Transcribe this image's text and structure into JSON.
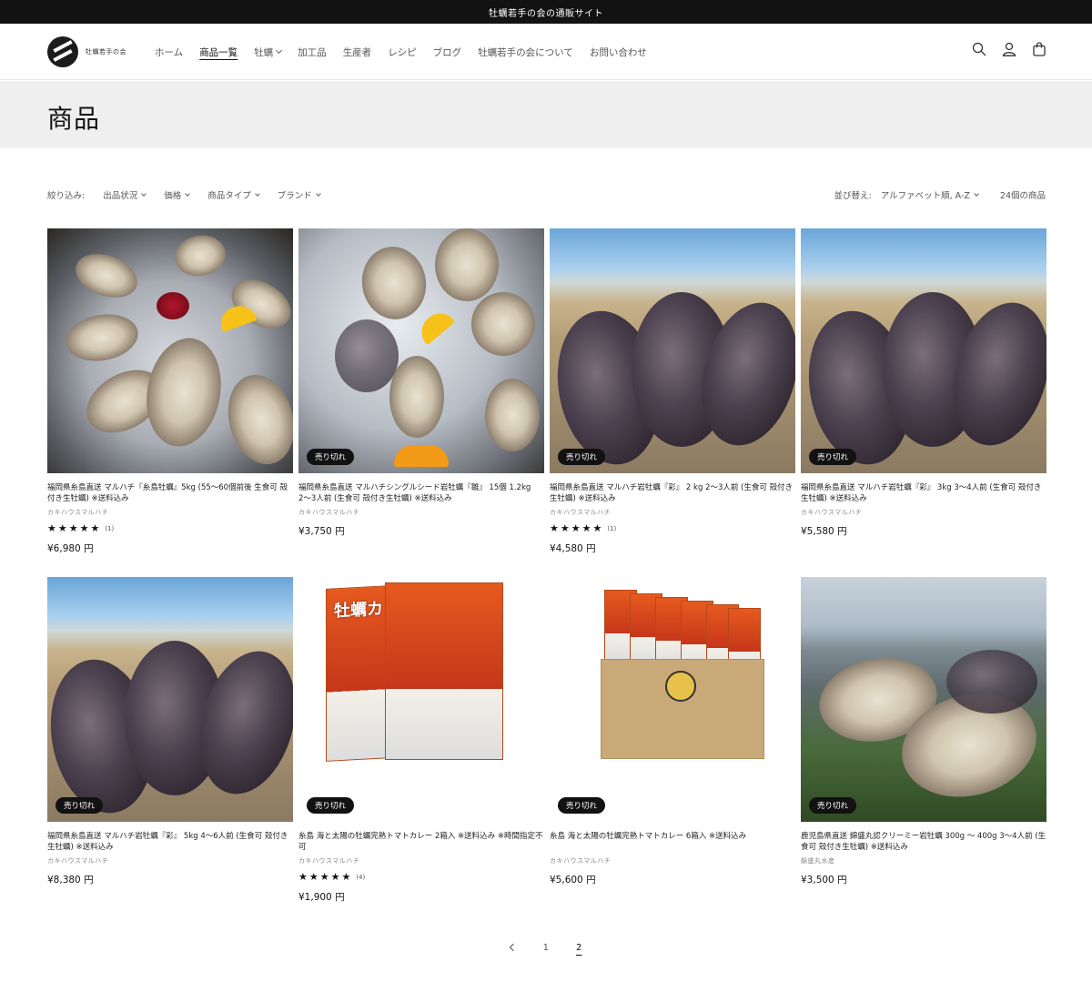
{
  "announcement": "牡蠣若手の会の通販サイト",
  "logo": {
    "text": "牡蠣若手の会"
  },
  "nav": [
    {
      "label": "ホーム",
      "active": false,
      "dropdown": false
    },
    {
      "label": "商品一覧",
      "active": true,
      "dropdown": false
    },
    {
      "label": "牡蠣",
      "active": false,
      "dropdown": true
    },
    {
      "label": "加工品",
      "active": false,
      "dropdown": false
    },
    {
      "label": "生産者",
      "active": false,
      "dropdown": false
    },
    {
      "label": "レシピ",
      "active": false,
      "dropdown": false
    },
    {
      "label": "ブログ",
      "active": false,
      "dropdown": false
    },
    {
      "label": "牡蠣若手の会について",
      "active": false,
      "dropdown": false
    },
    {
      "label": "お問い合わせ",
      "active": false,
      "dropdown": false
    }
  ],
  "header_icons": [
    "search-icon",
    "account-icon",
    "cart-icon"
  ],
  "page_title": "商品",
  "filters": {
    "label": "絞り込み:",
    "items": [
      "出品状況",
      "価格",
      "商品タイプ",
      "ブランド"
    ],
    "sort_label": "並び替え:",
    "sort_value": "アルファベット順, A-Z",
    "count": "24個の商品"
  },
  "products": [
    {
      "title": "福岡県糸島直送 マルハチ『糸島牡蠣』5kg (55〜60個前後 生食可 殻付き生牡蠣) ※送料込み",
      "vendor": "カキハウスマルハチ",
      "stars": "★★★★★",
      "reviews": "(1)",
      "price": "¥6,980 円",
      "sold_out": ""
    },
    {
      "title": "福岡県糸島直送 マルハチシングルシード岩牡蠣『雛』 15個 1.2kg 2〜3人前 (生食可 殻付き生牡蠣) ※送料込み",
      "vendor": "カキハウスマルハチ",
      "stars": "",
      "reviews": "",
      "price": "¥3,750 円",
      "sold_out": "売り切れ"
    },
    {
      "title": "福岡県糸島直送 マルハチ岩牡蠣『彩』 2 kg 2〜3人前 (生食可 殻付き生牡蠣) ※送料込み",
      "vendor": "カキハウスマルハチ",
      "stars": "★★★★★",
      "reviews": "(1)",
      "price": "¥4,580 円",
      "sold_out": "売り切れ"
    },
    {
      "title": "福岡県糸島直送 マルハチ岩牡蠣『彩』 3kg 3〜4人前 (生食可 殻付き生牡蠣) ※送料込み",
      "vendor": "カキハウスマルハチ",
      "stars": "",
      "reviews": "",
      "price": "¥5,580 円",
      "sold_out": "売り切れ"
    },
    {
      "title": "福岡県糸島直送 マルハチ岩牡蠣『彩』 5kg 4〜6人前 (生食可 殻付き生牡蠣) ※送料込み",
      "vendor": "カキハウスマルハチ",
      "stars": "",
      "reviews": "",
      "price": "¥8,380 円",
      "sold_out": "売り切れ"
    },
    {
      "title": "糸島 海と太陽の牡蠣完熟トマトカレー 2箱入 ※送料込み ※時間指定不可",
      "vendor": "カキハウスマルハチ",
      "stars": "★★★★★",
      "reviews": "(4)",
      "price": "¥1,900 円",
      "sold_out": "売り切れ",
      "box_text": "牡蠣カレー"
    },
    {
      "title": "糸島 海と太陽の牡蠣完熟トマトカレー 6箱入 ※送料込み",
      "vendor": "カキハウスマルハチ",
      "stars": "",
      "reviews": "",
      "price": "¥5,600 円",
      "sold_out": "売り切れ"
    },
    {
      "title": "鹿児島県直送 錦盛丸認クリーミー岩牡蠣 300g 〜 400g 3〜4人前 (生食可 殻付き生牡蠣) ※送料込み",
      "vendor": "錦盛丸水産",
      "stars": "",
      "reviews": "",
      "price": "¥3,500 円",
      "sold_out": "売り切れ"
    }
  ],
  "pagination": {
    "pages": [
      "1",
      "2"
    ],
    "current": "2"
  }
}
